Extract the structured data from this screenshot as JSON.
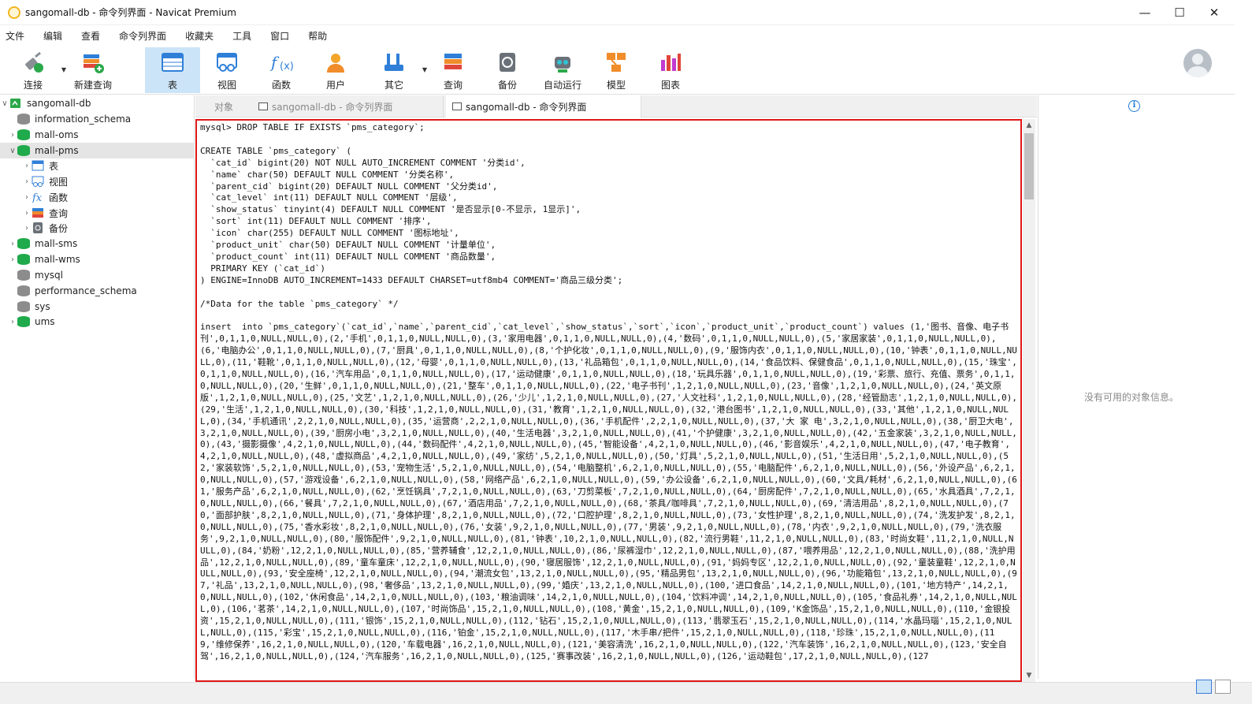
{
  "window": {
    "title": "sangomall-db - 命令列界面 - Navicat Premium",
    "minimize": "—",
    "maximize": "☐",
    "close": "✕"
  },
  "menu": [
    "文件",
    "编辑",
    "查看",
    "命令列界面",
    "收藏夹",
    "工具",
    "窗口",
    "帮助"
  ],
  "toolbar": {
    "connect": "连接",
    "new_query": "新建查询",
    "table": "表",
    "view": "视图",
    "function": "函数",
    "user": "用户",
    "other": "其它",
    "query": "查询",
    "backup": "备份",
    "automation": "自动运行",
    "model": "模型",
    "chart": "图表"
  },
  "sidebar": {
    "root": "sangomall-db",
    "items": [
      "information_schema",
      "mall-oms",
      "mall-pms",
      "表",
      "视图",
      "函数",
      "查询",
      "备份",
      "mall-sms",
      "mall-wms",
      "mysql",
      "performance_schema",
      "sys",
      "ums"
    ]
  },
  "tabs": [
    "对象",
    "sangomall-db - 命令列界面",
    "sangomall-db - 命令列界面"
  ],
  "editor": {
    "content": "mysql> DROP TABLE IF EXISTS `pms_category`;\n\nCREATE TABLE `pms_category` (\n  `cat_id` bigint(20) NOT NULL AUTO_INCREMENT COMMENT '分类id',\n  `name` char(50) DEFAULT NULL COMMENT '分类名称',\n  `parent_cid` bigint(20) DEFAULT NULL COMMENT '父分类id',\n  `cat_level` int(11) DEFAULT NULL COMMENT '层级',\n  `show_status` tinyint(4) DEFAULT NULL COMMENT '是否显示[0-不显示, 1显示]',\n  `sort` int(11) DEFAULT NULL COMMENT '排序',\n  `icon` char(255) DEFAULT NULL COMMENT '图标地址',\n  `product_unit` char(50) DEFAULT NULL COMMENT '计量单位',\n  `product_count` int(11) DEFAULT NULL COMMENT '商品数量',\n  PRIMARY KEY (`cat_id`)\n) ENGINE=InnoDB AUTO_INCREMENT=1433 DEFAULT CHARSET=utf8mb4 COMMENT='商品三级分类';\n\n/*Data for the table `pms_category` */\n\ninsert  into `pms_category`(`cat_id`,`name`,`parent_cid`,`cat_level`,`show_status`,`sort`,`icon`,`product_unit`,`product_count`) values (1,'图书、音像、电子书刊',0,1,1,0,NULL,NULL,0),(2,'手机',0,1,1,0,NULL,NULL,0),(3,'家用电器',0,1,1,0,NULL,NULL,0),(4,'数码',0,1,1,0,NULL,NULL,0),(5,'家居家装',0,1,1,0,NULL,NULL,0),(6,'电脑办公',0,1,1,0,NULL,NULL,0),(7,'厨具',0,1,1,0,NULL,NULL,0),(8,'个护化妆',0,1,1,0,NULL,NULL,0),(9,'服饰内衣',0,1,1,0,NULL,NULL,0),(10,'钟表',0,1,1,0,NULL,NULL,0),(11,'鞋靴',0,1,1,0,NULL,NULL,0),(12,'母婴',0,1,1,0,NULL,NULL,0),(13,'礼品箱包',0,1,1,0,NULL,NULL,0),(14,'食品饮料、保健食品',0,1,1,0,NULL,NULL,0),(15,'珠宝',0,1,1,0,NULL,NULL,0),(16,'汽车用品',0,1,1,0,NULL,NULL,0),(17,'运动健康',0,1,1,0,NULL,NULL,0),(18,'玩具乐器',0,1,1,0,NULL,NULL,0),(19,'彩票、旅行、充值、票务',0,1,1,0,NULL,NULL,0),(20,'生鲜',0,1,1,0,NULL,NULL,0),(21,'整车',0,1,1,0,NULL,NULL,0),(22,'电子书刊',1,2,1,0,NULL,NULL,0),(23,'音像',1,2,1,0,NULL,NULL,0),(24,'英文原版',1,2,1,0,NULL,NULL,0),(25,'文艺',1,2,1,0,NULL,NULL,0),(26,'少儿',1,2,1,0,NULL,NULL,0),(27,'人文社科',1,2,1,0,NULL,NULL,0),(28,'经管励志',1,2,1,0,NULL,NULL,0),(29,'生活',1,2,1,0,NULL,NULL,0),(30,'科技',1,2,1,0,NULL,NULL,0),(31,'教育',1,2,1,0,NULL,NULL,0),(32,'港台图书',1,2,1,0,NULL,NULL,0),(33,'其他',1,2,1,0,NULL,NULL,0),(34,'手机通讯',2,2,1,0,NULL,NULL,0),(35,'运营商',2,2,1,0,NULL,NULL,0),(36,'手机配件',2,2,1,0,NULL,NULL,0),(37,'大 家 电',3,2,1,0,NULL,NULL,0),(38,'厨卫大电',3,2,1,0,NULL,NULL,0),(39,'厨房小电',3,2,1,0,NULL,NULL,0),(40,'生活电器',3,2,1,0,NULL,NULL,0),(41,'个护健康',3,2,1,0,NULL,NULL,0),(42,'五金家装',3,2,1,0,NULL,NULL,0),(43,'摄影摄像',4,2,1,0,NULL,NULL,0),(44,'数码配件',4,2,1,0,NULL,NULL,0),(45,'智能设备',4,2,1,0,NULL,NULL,0),(46,'影音娱乐',4,2,1,0,NULL,NULL,0),(47,'电子教育',4,2,1,0,NULL,NULL,0),(48,'虚拟商品',4,2,1,0,NULL,NULL,0),(49,'家纺',5,2,1,0,NULL,NULL,0),(50,'灯具',5,2,1,0,NULL,NULL,0),(51,'生活日用',5,2,1,0,NULL,NULL,0),(52,'家装软饰',5,2,1,0,NULL,NULL,0),(53,'宠物生活',5,2,1,0,NULL,NULL,0),(54,'电脑整机',6,2,1,0,NULL,NULL,0),(55,'电脑配件',6,2,1,0,NULL,NULL,0),(56,'外设产品',6,2,1,0,NULL,NULL,0),(57,'游戏设备',6,2,1,0,NULL,NULL,0),(58,'网络产品',6,2,1,0,NULL,NULL,0),(59,'办公设备',6,2,1,0,NULL,NULL,0),(60,'文具/耗材',6,2,1,0,NULL,NULL,0),(61,'服务产品',6,2,1,0,NULL,NULL,0),(62,'烹饪锅具',7,2,1,0,NULL,NULL,0),(63,'刀剪菜板',7,2,1,0,NULL,NULL,0),(64,'厨房配件',7,2,1,0,NULL,NULL,0),(65,'水具酒具',7,2,1,0,NULL,NULL,0),(66,'餐具',7,2,1,0,NULL,NULL,0),(67,'酒店用品',7,2,1,0,NULL,NULL,0),(68,'茶具/咖啡具',7,2,1,0,NULL,NULL,0),(69,'清洁用品',8,2,1,0,NULL,NULL,0),(70,'面部护肤',8,2,1,0,NULL,NULL,0),(71,'身体护理',8,2,1,0,NULL,NULL,0),(72,'口腔护理',8,2,1,0,NULL,NULL,0),(73,'女性护理',8,2,1,0,NULL,NULL,0),(74,'洗发护发',8,2,1,0,NULL,NULL,0),(75,'香水彩妆',8,2,1,0,NULL,NULL,0),(76,'女装',9,2,1,0,NULL,NULL,0),(77,'男装',9,2,1,0,NULL,NULL,0),(78,'内衣',9,2,1,0,NULL,NULL,0),(79,'洗衣服务',9,2,1,0,NULL,NULL,0),(80,'服饰配件',9,2,1,0,NULL,NULL,0),(81,'钟表',10,2,1,0,NULL,NULL,0),(82,'流行男鞋',11,2,1,0,NULL,NULL,0),(83,'时尚女鞋',11,2,1,0,NULL,NULL,0),(84,'奶粉',12,2,1,0,NULL,NULL,0),(85,'营养辅食',12,2,1,0,NULL,NULL,0),(86,'尿裤湿巾',12,2,1,0,NULL,NULL,0),(87,'喂养用品',12,2,1,0,NULL,NULL,0),(88,'洗护用品',12,2,1,0,NULL,NULL,0),(89,'童车童床',12,2,1,0,NULL,NULL,0),(90,'寝居服饰',12,2,1,0,NULL,NULL,0),(91,'妈妈专区',12,2,1,0,NULL,NULL,0),(92,'童装童鞋',12,2,1,0,NULL,NULL,0),(93,'安全座椅',12,2,1,0,NULL,NULL,0),(94,'潮流女包',13,2,1,0,NULL,NULL,0),(95,'精品男包',13,2,1,0,NULL,NULL,0),(96,'功能箱包',13,2,1,0,NULL,NULL,0),(97,'礼品',13,2,1,0,NULL,NULL,0),(98,'奢侈品',13,2,1,0,NULL,NULL,0),(99,'婚庆',13,2,1,0,NULL,NULL,0),(100,'进口食品',14,2,1,0,NULL,NULL,0),(101,'地方特产',14,2,1,0,NULL,NULL,0),(102,'休闲食品',14,2,1,0,NULL,NULL,0),(103,'粮油调味',14,2,1,0,NULL,NULL,0),(104,'饮料冲调',14,2,1,0,NULL,NULL,0),(105,'食品礼券',14,2,1,0,NULL,NULL,0),(106,'茗茶',14,2,1,0,NULL,NULL,0),(107,'时尚饰品',15,2,1,0,NULL,NULL,0),(108,'黄金',15,2,1,0,NULL,NULL,0),(109,'K金饰品',15,2,1,0,NULL,NULL,0),(110,'金银投资',15,2,1,0,NULL,NULL,0),(111,'银饰',15,2,1,0,NULL,NULL,0),(112,'钻石',15,2,1,0,NULL,NULL,0),(113,'翡翠玉石',15,2,1,0,NULL,NULL,0),(114,'水晶玛瑙',15,2,1,0,NULL,NULL,0),(115,'彩宝',15,2,1,0,NULL,NULL,0),(116,'铂金',15,2,1,0,NULL,NULL,0),(117,'木手串/把件',15,2,1,0,NULL,NULL,0),(118,'珍珠',15,2,1,0,NULL,NULL,0),(119,'维修保养',16,2,1,0,NULL,NULL,0),(120,'车载电器',16,2,1,0,NULL,NULL,0),(121,'美容清洗',16,2,1,0,NULL,NULL,0),(122,'汽车装饰',16,2,1,0,NULL,NULL,0),(123,'安全自驾',16,2,1,0,NULL,NULL,0),(124,'汽车服务',16,2,1,0,NULL,NULL,0),(125,'赛事改装',16,2,1,0,NULL,NULL,0),(126,'运动鞋包',17,2,1,0,NULL,NULL,0),(127"
  },
  "right_panel": {
    "info_icon": "i",
    "empty_message": "没有可用的对象信息。"
  },
  "colors": {
    "highlight_border": "#e01818",
    "active_tab_bg": "#cce4f7",
    "db_green": "#1faa4b"
  }
}
